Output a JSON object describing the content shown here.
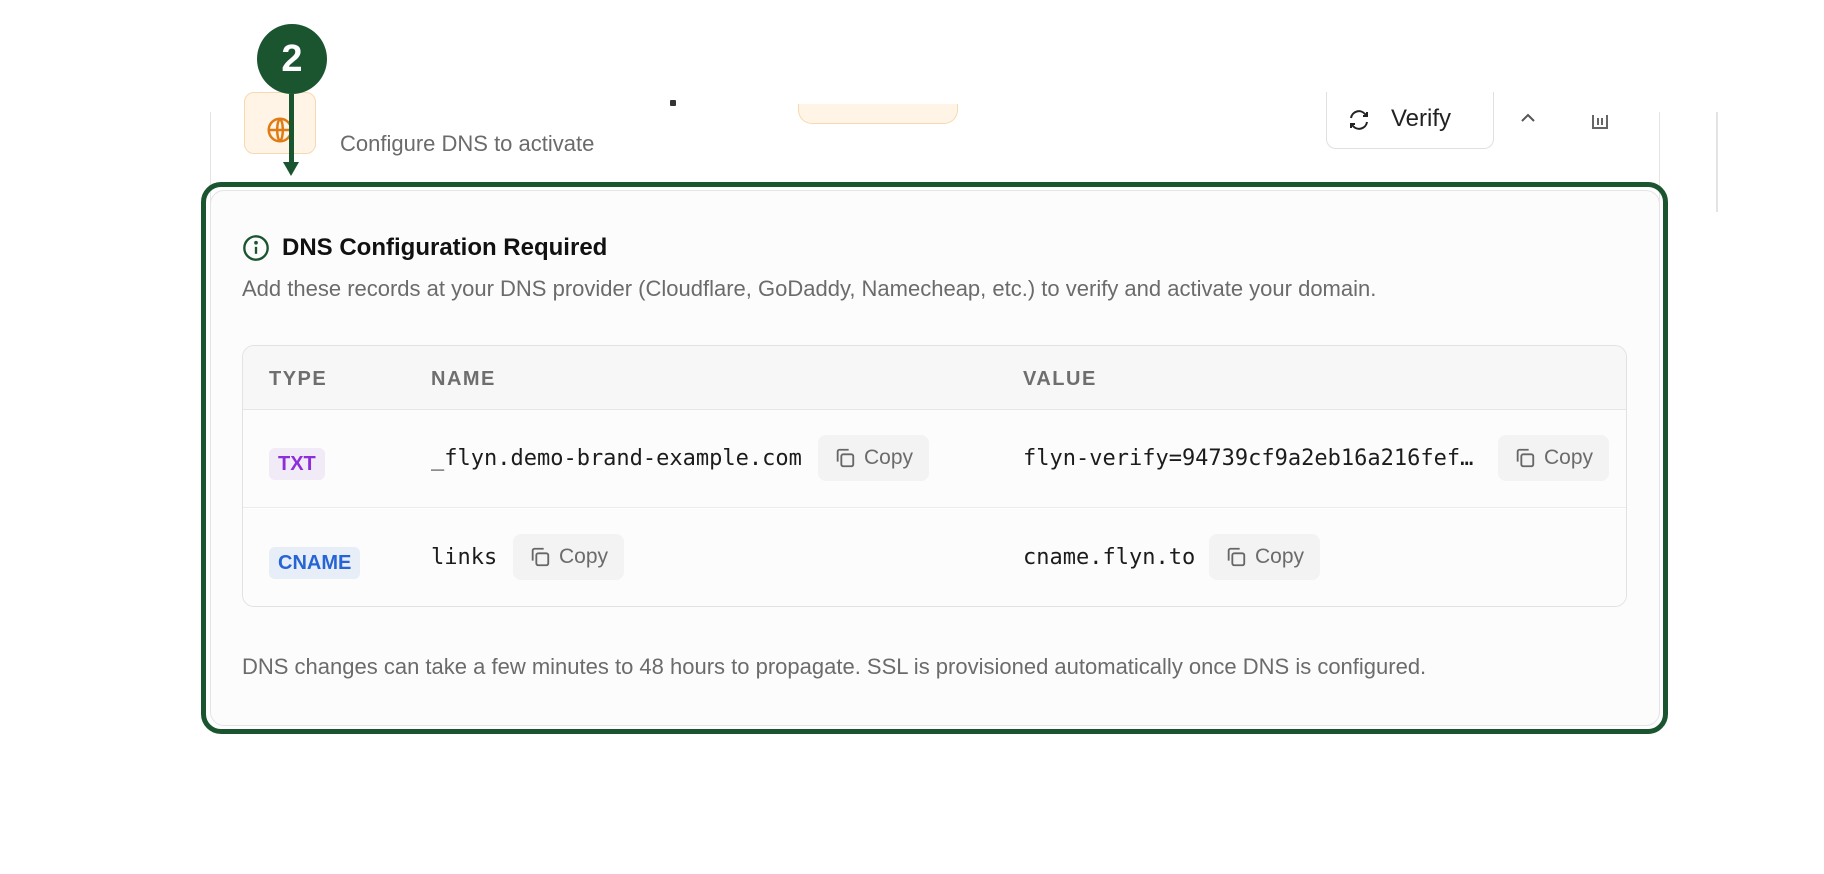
{
  "step": {
    "number": "2"
  },
  "domain": {
    "subtitle": "Configure DNS to activate",
    "verify_label": "Verify"
  },
  "dns": {
    "title": "DNS Configuration Required",
    "description": "Add these records at your DNS provider (Cloudflare, GoDaddy, Namecheap, etc.) to verify and activate your domain.",
    "columns": {
      "type": "TYPE",
      "name": "NAME",
      "value": "VALUE"
    },
    "records": [
      {
        "type": "TXT",
        "name": "_flyn.demo-brand-example.com",
        "value": "flyn-verify=94739cf9a2eb16a216fef…",
        "copy_label": "Copy"
      },
      {
        "type": "CNAME",
        "name": "links",
        "value": "cname.flyn.to",
        "copy_label": "Copy"
      }
    ],
    "footer": "DNS changes can take a few minutes to 48 hours to propagate. SSL is provisioned automatically once DNS is configured."
  },
  "colors": {
    "accent": "#1a5530",
    "txt_badge": "#8b2fd9",
    "cname_badge": "#2565d4",
    "warning_bg": "#fff4e6"
  },
  "icons": [
    "globe-icon",
    "refresh-icon",
    "chevron-up-icon",
    "trash-icon",
    "info-icon",
    "copy-icon"
  ]
}
